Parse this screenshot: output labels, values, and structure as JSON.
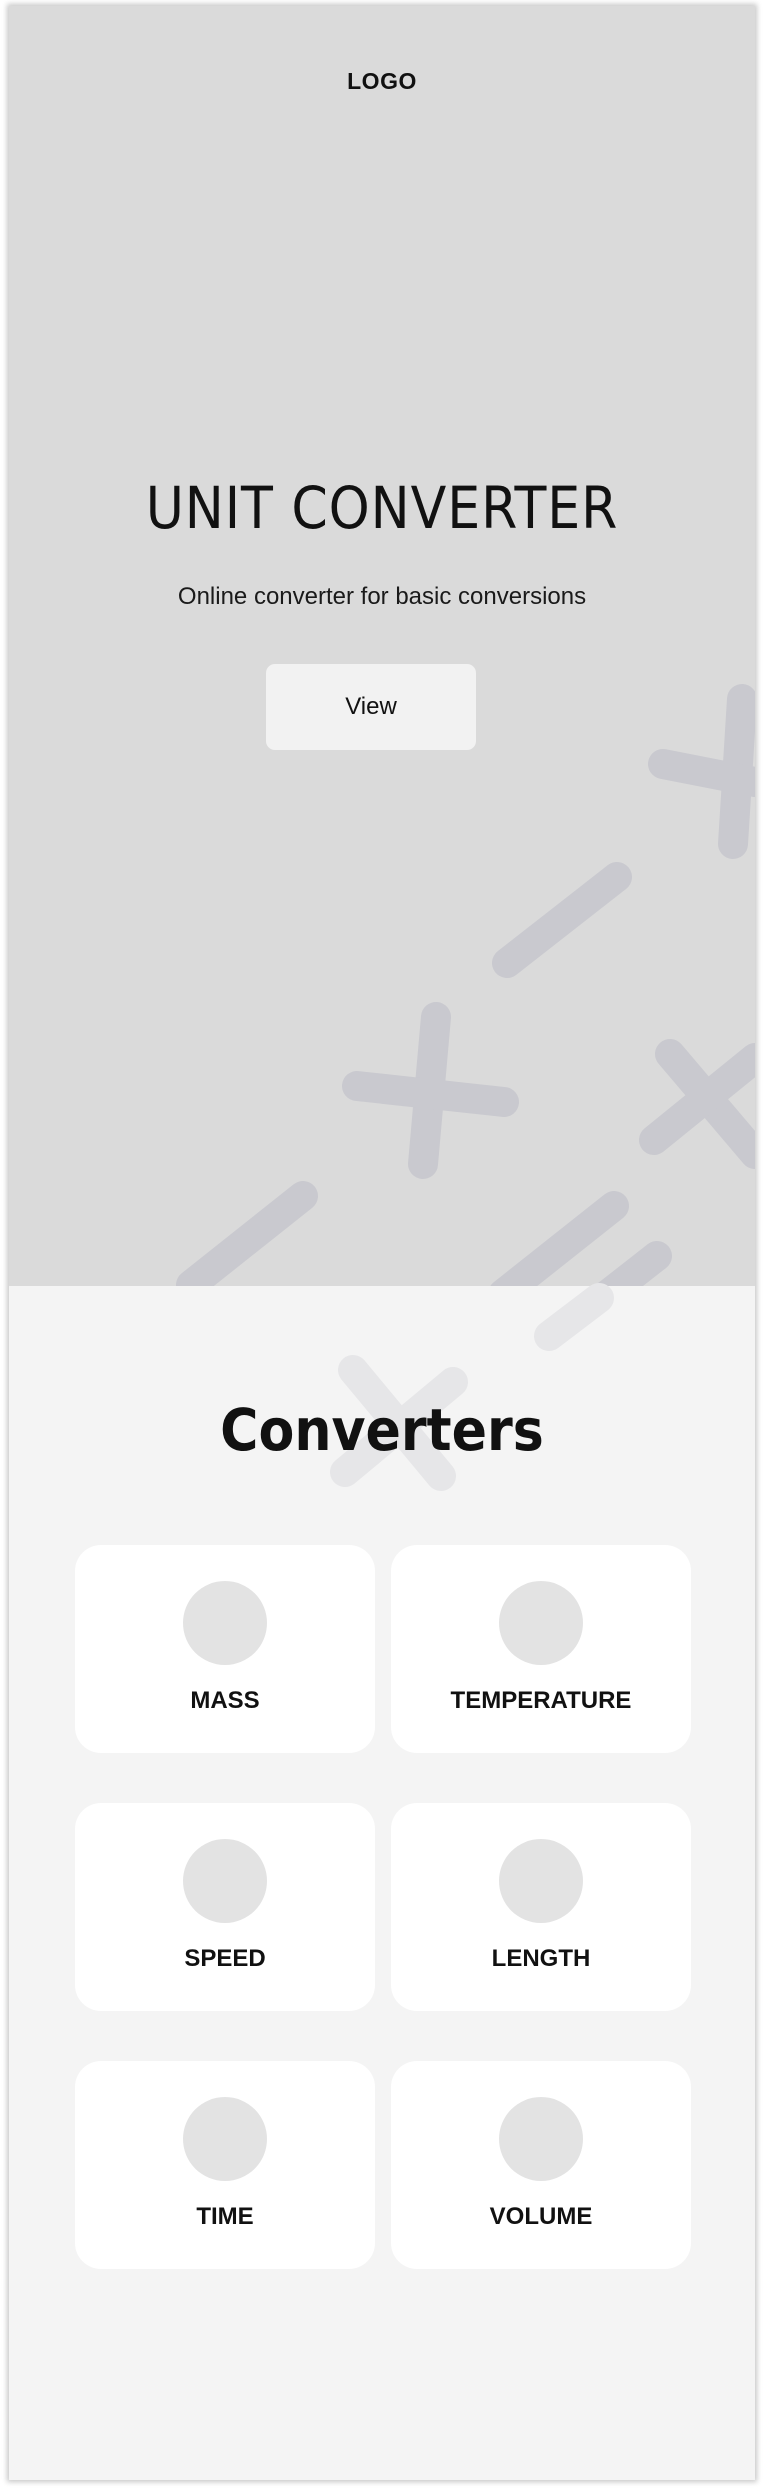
{
  "header": {
    "logo": "LOGO"
  },
  "hero": {
    "title": "UNIT CONVERTER",
    "subtitle": "Online converter for basic conversions",
    "view_label": "View"
  },
  "converters": {
    "title": "Converters",
    "items": [
      {
        "label": "MASS"
      },
      {
        "label": "TEMPERATURE"
      },
      {
        "label": "SPEED"
      },
      {
        "label": "LENGTH"
      },
      {
        "label": "TIME"
      },
      {
        "label": "VOLUME"
      }
    ]
  },
  "colors": {
    "hero_background": "#dadada",
    "page_background": "#f4f4f4",
    "card_background": "#ffffff",
    "icon_placeholder": "#e3e3e3",
    "decoration": "#c9c9cf"
  }
}
